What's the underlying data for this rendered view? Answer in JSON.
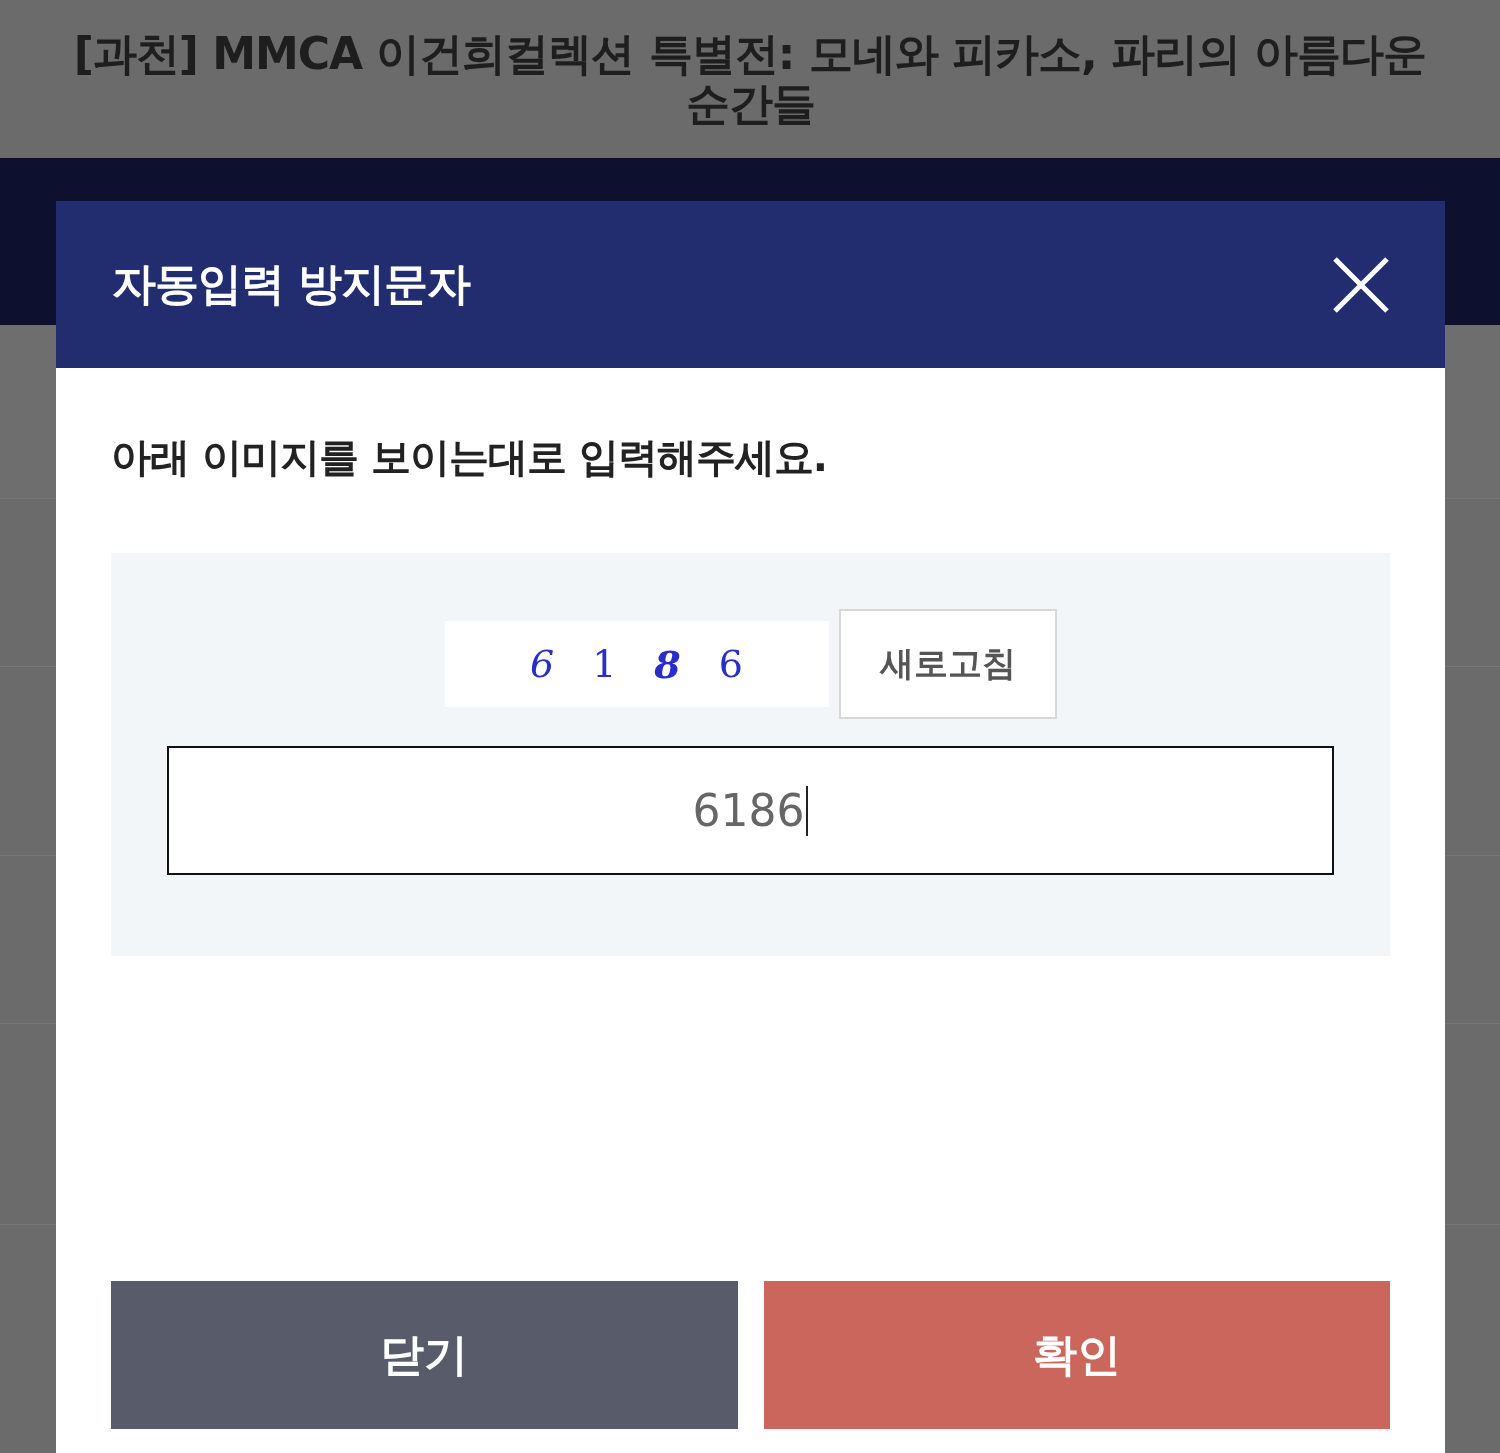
{
  "page": {
    "title": "[과천] MMCA 이건희컬렉션 특별전: 모네와 피카소, 파리의 아름다운 순간들"
  },
  "dialog": {
    "title": "자동입력 방지문자",
    "instruction": "아래 이미지를 보이는대로 입력해주세요.",
    "captcha": {
      "characters": [
        "6",
        "1",
        "8",
        "6"
      ],
      "refresh_button": "새로고침"
    },
    "answer": {
      "value": "6186"
    },
    "buttons": [
      {
        "kind": "close",
        "label": "닫기"
      },
      {
        "kind": "confirm",
        "label": "확인"
      }
    ]
  }
}
